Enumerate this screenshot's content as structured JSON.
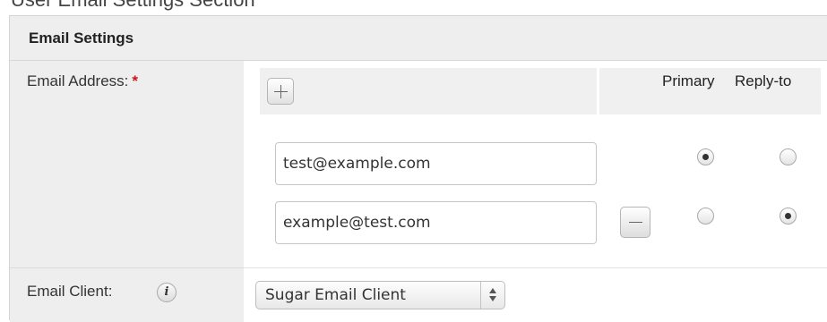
{
  "top_strip_text": "User Email Settings Section",
  "panel": {
    "title": "Email Settings"
  },
  "fields": {
    "email_address": {
      "label": "Email Address:",
      "required_marker": "*"
    },
    "email_client": {
      "label": "Email Client:",
      "info_icon": "i"
    }
  },
  "email_table": {
    "add_button": "add-icon",
    "columns": [
      "Primary",
      "Reply-to"
    ],
    "rows": [
      {
        "email": "test@example.com",
        "primary": true,
        "reply_to": false,
        "removable": false
      },
      {
        "email": "example@test.com",
        "primary": false,
        "reply_to": true,
        "removable": true
      }
    ]
  },
  "email_client_select": {
    "selected": "Sugar Email Client"
  },
  "colors": {
    "required": "#d0121b",
    "label_bg": "#eeeeee",
    "header_bg": "#f0f0f0"
  }
}
